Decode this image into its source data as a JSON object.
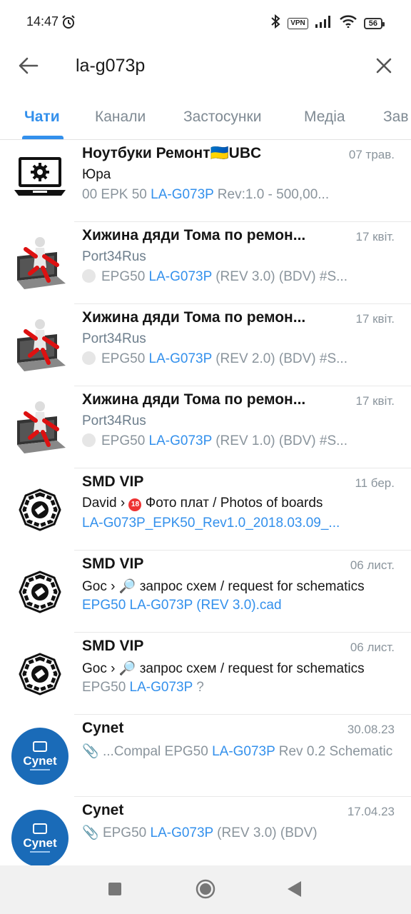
{
  "status": {
    "time": "14:47",
    "vpn": "VPN",
    "battery": "56"
  },
  "search": {
    "query": "la-g073p"
  },
  "tabs": [
    {
      "label": "Чати"
    },
    {
      "label": "Канали"
    },
    {
      "label": "Застосунки"
    },
    {
      "label": "Медіа"
    },
    {
      "label": "Зав"
    }
  ],
  "results": [
    {
      "title": "Ноутбуки Ремонт🇺🇦UBC",
      "date": "07 трав.",
      "line2": "Юра",
      "line3_pre": "00  EPK 50  ",
      "line3_hl": "LA-G073P",
      "line3_post": "  Rev:1.0  - 500,00..."
    },
    {
      "title": "Хижина дяди Тома по ремон...",
      "date": "17 квіт.",
      "line2": "Port34Rus",
      "line3_pre": "EPG50 ",
      "line3_hl": "LA-G073P",
      "line3_post": " (REV 3.0) (BDV) #S..."
    },
    {
      "title": "Хижина дяди Тома по ремон...",
      "date": "17 квіт.",
      "line2": "Port34Rus",
      "line3_pre": "EPG50 ",
      "line3_hl": "LA-G073P",
      "line3_post": " (REV 2.0) (BDV) #S..."
    },
    {
      "title": "Хижина дяди Тома по ремон...",
      "date": "17 квіт.",
      "line2": "Port34Rus",
      "line3_pre": "EPG50 ",
      "line3_hl": "LA-G073P",
      "line3_post": " (REV 1.0) (BDV) #S..."
    },
    {
      "title": "SMD VIP",
      "date": "11 бер.",
      "line2_sender": "David",
      "line2_topic": "Фото плат / Photos of boards",
      "line3": "LA-G073P_EPK50_Rev1.0_2018.03.09_..."
    },
    {
      "title": "SMD VIP",
      "date": "06 лист.",
      "line2_sender": "Goc",
      "line2_topic": "запрос схем / request for schematics",
      "line3": "EPG50 LA-G073P (REV 3.0).cad"
    },
    {
      "title": "SMD VIP",
      "date": "06 лист.",
      "line2_sender": "Goc",
      "line2_topic": "запрос схем / request for schematics",
      "line3_pre": "EPG50 ",
      "line3_hl": "LA-G073P",
      "line3_post": " ?"
    },
    {
      "title": "Cynet",
      "date": "30.08.23",
      "avatar_text": "Cynet",
      "line2_pre": "...Compal EPG50 ",
      "line2_hl": "LA-G073P",
      "line2_post": " Rev 0.2 Schematic"
    },
    {
      "title": "Cynet",
      "date": "17.04.23",
      "avatar_text": "Cynet",
      "line2_pre": "EPG50 ",
      "line2_hl": "LA-G073P",
      "line2_post": " (REV 3.0) (BDV)"
    }
  ],
  "colors": {
    "accent": "#3390ec",
    "secondary_text": "#8a949c",
    "cynet_blue": "#1a6bb8"
  }
}
